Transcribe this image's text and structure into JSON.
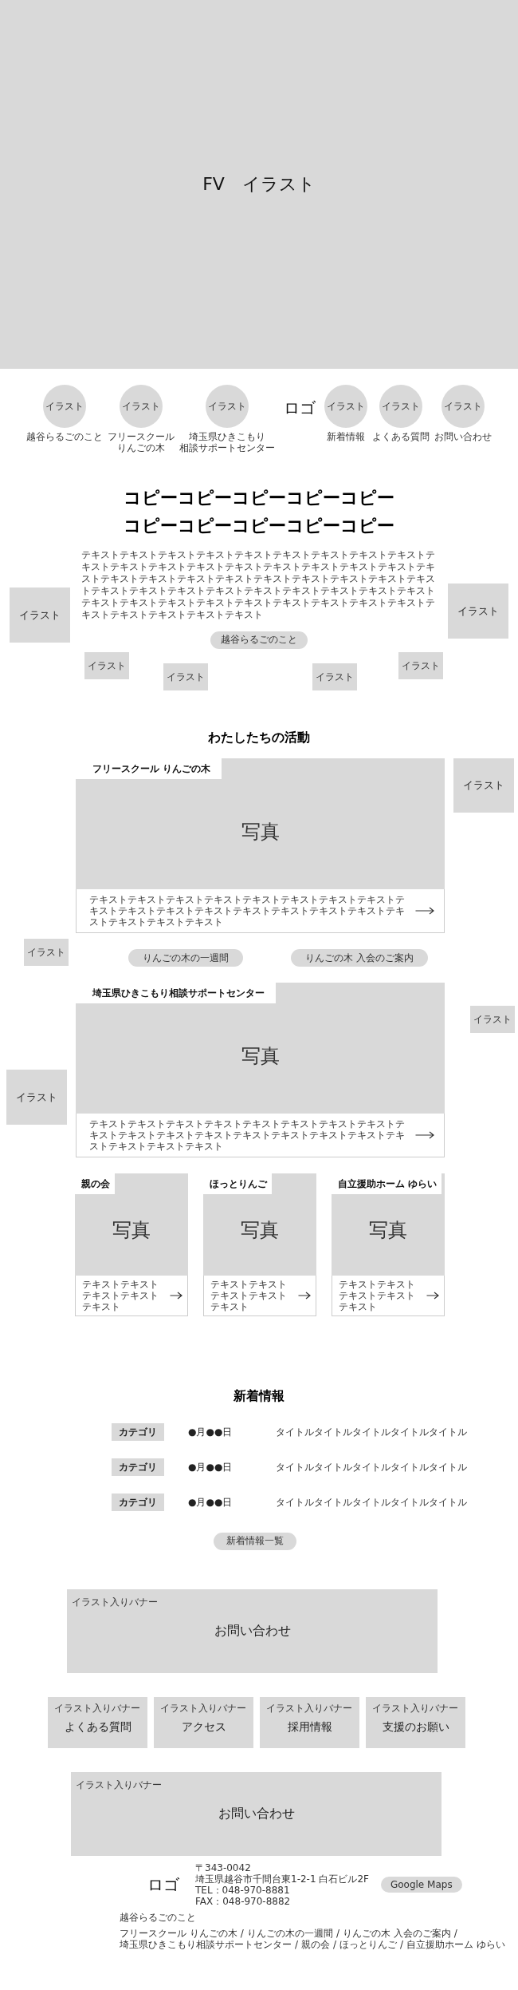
{
  "fv": {
    "label": "FV　イラスト"
  },
  "nav": {
    "logo": "ロゴ",
    "items": [
      {
        "icon": "イラスト",
        "label_lines": [
          "越谷らるごのこと"
        ]
      },
      {
        "icon": "イラスト",
        "label_lines": [
          "フリースクール",
          "りんごの木"
        ]
      },
      {
        "icon": "イラスト",
        "label_lines": [
          "埼玉県ひきこもり",
          "相談サポートセンター"
        ]
      },
      {
        "icon": "イラスト",
        "label_lines": [
          "新着情報"
        ]
      },
      {
        "icon": "イラスト",
        "label_lines": [
          "よくある質問"
        ]
      },
      {
        "icon": "イラスト",
        "label_lines": [
          "お問い合わせ"
        ]
      }
    ]
  },
  "hero": {
    "headline": [
      "コピーコピーコピーコピーコピー",
      "コピーコピーコピーコピーコピー"
    ],
    "text": "テキストテキストテキストテキストテキストテキストテキストテキストテキストテキストテキストテキストテキストテキストテキストテキストテキストテキストテキストテキストテキストテキストテキストテキストテキストテキストテキストテキストテキストテキストテキストテキストテキストテキストテキストテキストテキストテキストテキストテキストテキストテキストテキストテキストテキストテキストテキストテキストテキストテキストテキスト",
    "button": "越谷らるごのこと",
    "illustrations": [
      "イラスト",
      "イラスト",
      "イラスト",
      "イラスト",
      "イラスト",
      "イラスト"
    ]
  },
  "activities": {
    "title": "わたしたちの活動",
    "illustrations": [
      "イラスト",
      "イラスト",
      "イラスト",
      "イラスト"
    ],
    "featured": [
      {
        "title": "フリースクール りんごの木",
        "photo": "写真",
        "text": "テキストテキストテキストテキストテキストテキストテキストテキストテキストテキストテキストテキストテキストテキストテキストテキストテキストテキストテキストテキスト",
        "buttons": [
          "りんごの木の一週間",
          "りんごの木 入会のご案内"
        ]
      },
      {
        "title": "埼玉県ひきこもり相談サポートセンター",
        "photo": "写真",
        "text": "テキストテキストテキストテキストテキストテキストテキストテキストテキストテキストテキストテキストテキストテキストテキストテキストテキストテキストテキストテキスト"
      }
    ],
    "cards": [
      {
        "title": "親の会",
        "photo": "写真",
        "text": "テキストテキストテキストテキストテキスト"
      },
      {
        "title": "ほっとりんご",
        "photo": "写真",
        "text": "テキストテキストテキストテキストテキスト"
      },
      {
        "title": "自立援助ホーム ゆらい",
        "photo": "写真",
        "text": "テキストテキストテキストテキストテキスト"
      }
    ]
  },
  "news": {
    "title": "新着情報",
    "items": [
      {
        "category": "カテゴリ",
        "date": "●月●●日",
        "title": "タイトルタイトルタイトルタイトルタイトル"
      },
      {
        "category": "カテゴリ",
        "date": "●月●●日",
        "title": "タイトルタイトルタイトルタイトルタイトル"
      },
      {
        "category": "カテゴリ",
        "date": "●月●●日",
        "title": "タイトルタイトルタイトルタイトルタイトル"
      }
    ],
    "button": "新着情報一覧"
  },
  "banner_main": {
    "label": "イラスト入りバナー",
    "title": "お問い合わせ"
  },
  "banners": [
    {
      "label": "イラスト入りバナー",
      "title": "よくある質問"
    },
    {
      "label": "イラスト入りバナー",
      "title": "アクセス"
    },
    {
      "label": "イラスト入りバナー",
      "title": "採用情報"
    },
    {
      "label": "イラスト入りバナー",
      "title": "支援のお願い"
    }
  ],
  "banner_bottom": {
    "label": "イラスト入りバナー",
    "title": "お問い合わせ"
  },
  "footer": {
    "logo": "ロゴ",
    "address": [
      "〒343-0042",
      "埼玉県越谷市千間台東1-2-1 白石ビル2F",
      "TEL：048-970-8881",
      "FAX：048-970-8882"
    ],
    "map_button": "Google Maps",
    "about": "越谷らるごのこと",
    "link_lines": [
      [
        "フリースクール りんごの木",
        "りんごの木の一週間",
        "りんごの木 入会のご案内"
      ],
      [
        "埼玉県ひきこもり相談サポートセンター",
        "親の会",
        "ほっとりんご",
        "自立援助ホーム ゆらい"
      ]
    ],
    "separator": "/"
  }
}
